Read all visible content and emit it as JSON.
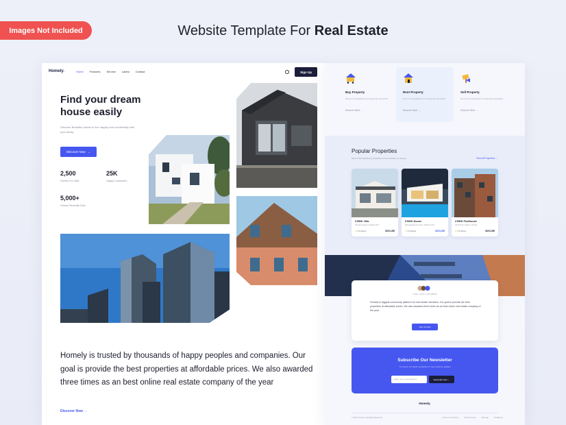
{
  "badge": "Images Not Included",
  "headline": {
    "normal": "Website Template For ",
    "bold": "Real Estate"
  },
  "left_page": {
    "logo": {
      "text": "Homely",
      "dot": "."
    },
    "nav": [
      "Home",
      "Features",
      "Service",
      "Latest",
      "Contact"
    ],
    "signup": "Sign Up",
    "hero_title": "Find your dream house easily",
    "hero_text": "Discover Beautiful places to live happily and comfortably with your family.",
    "discover_button": "Discover Now",
    "stats": [
      {
        "value": "2,500",
        "label": "Homes For Sale"
      },
      {
        "value": "25K",
        "label": "Happy Customers"
      },
      {
        "value": "5,000+",
        "label": "Homes Recently Sold"
      }
    ],
    "about_text": "Homely is trusted by thousands of happy peoples and companies. Our goal is provide the best properties at affordable prices. We also awarded three times as an best online real estate company of the year",
    "about_link": "Discover Now"
  },
  "right_page": {
    "services": [
      {
        "title": "Buy Property",
        "desc": "Here is the guidelines for buying the properties",
        "more": "Discover More"
      },
      {
        "title": "Rent Property",
        "desc": "Here is the guidelines for buying the properties",
        "more": "Discover More"
      },
      {
        "title": "Sell Property",
        "desc": "Here is the guidelines for buying the properties",
        "more": "Discover More"
      }
    ],
    "popular_title": "Popular Properties",
    "popular_sub": "Here is the best/luxury properties to be purchase on Homely",
    "view_all": "View All Properties",
    "properties": [
      {
        "name": "3 BHK Villa",
        "location": "Mohammadpur, Dhaka 1207",
        "rating": "4.8 Rating",
        "price": "$25,185"
      },
      {
        "name": "5 BHK House",
        "location": "Rangsagarband 1111, Dhaka 1212",
        "rating": "4.8 Rating",
        "price": "$25,185"
      },
      {
        "name": "4 BHK Penthouse",
        "location": "45 Mohammadpur, Dhaka",
        "rating": "4.8 Rating",
        "price": "$25,185"
      }
    ],
    "about_caption": "5,000+ HAPPY CUSTOMERS",
    "about_text": "Homely is biggest community platform for real estate members. Our goal is provide the best properties at affordable prices. We also awarded three times as an best online real estate company of the year",
    "about_button": "Join Us Now",
    "newsletter_title": "Subscribe Our Newsletter",
    "newsletter_sub": "To receive our latest newsletter for new property updates",
    "email_placeholder": "Enter your email address",
    "subscribe_button": "Subscribe Now",
    "footer_logo": {
      "text": "Homely",
      "dot": "."
    },
    "copyright": "© 2023 Homely. All Rights Reserved",
    "footer_links": [
      "Terms & Conditions",
      "Privacy Policy",
      "Sitemap",
      "Disclaimer"
    ]
  },
  "colors": {
    "accent": "#4657f0",
    "dark": "#1b1e3a",
    "badge": "#ef5250"
  }
}
